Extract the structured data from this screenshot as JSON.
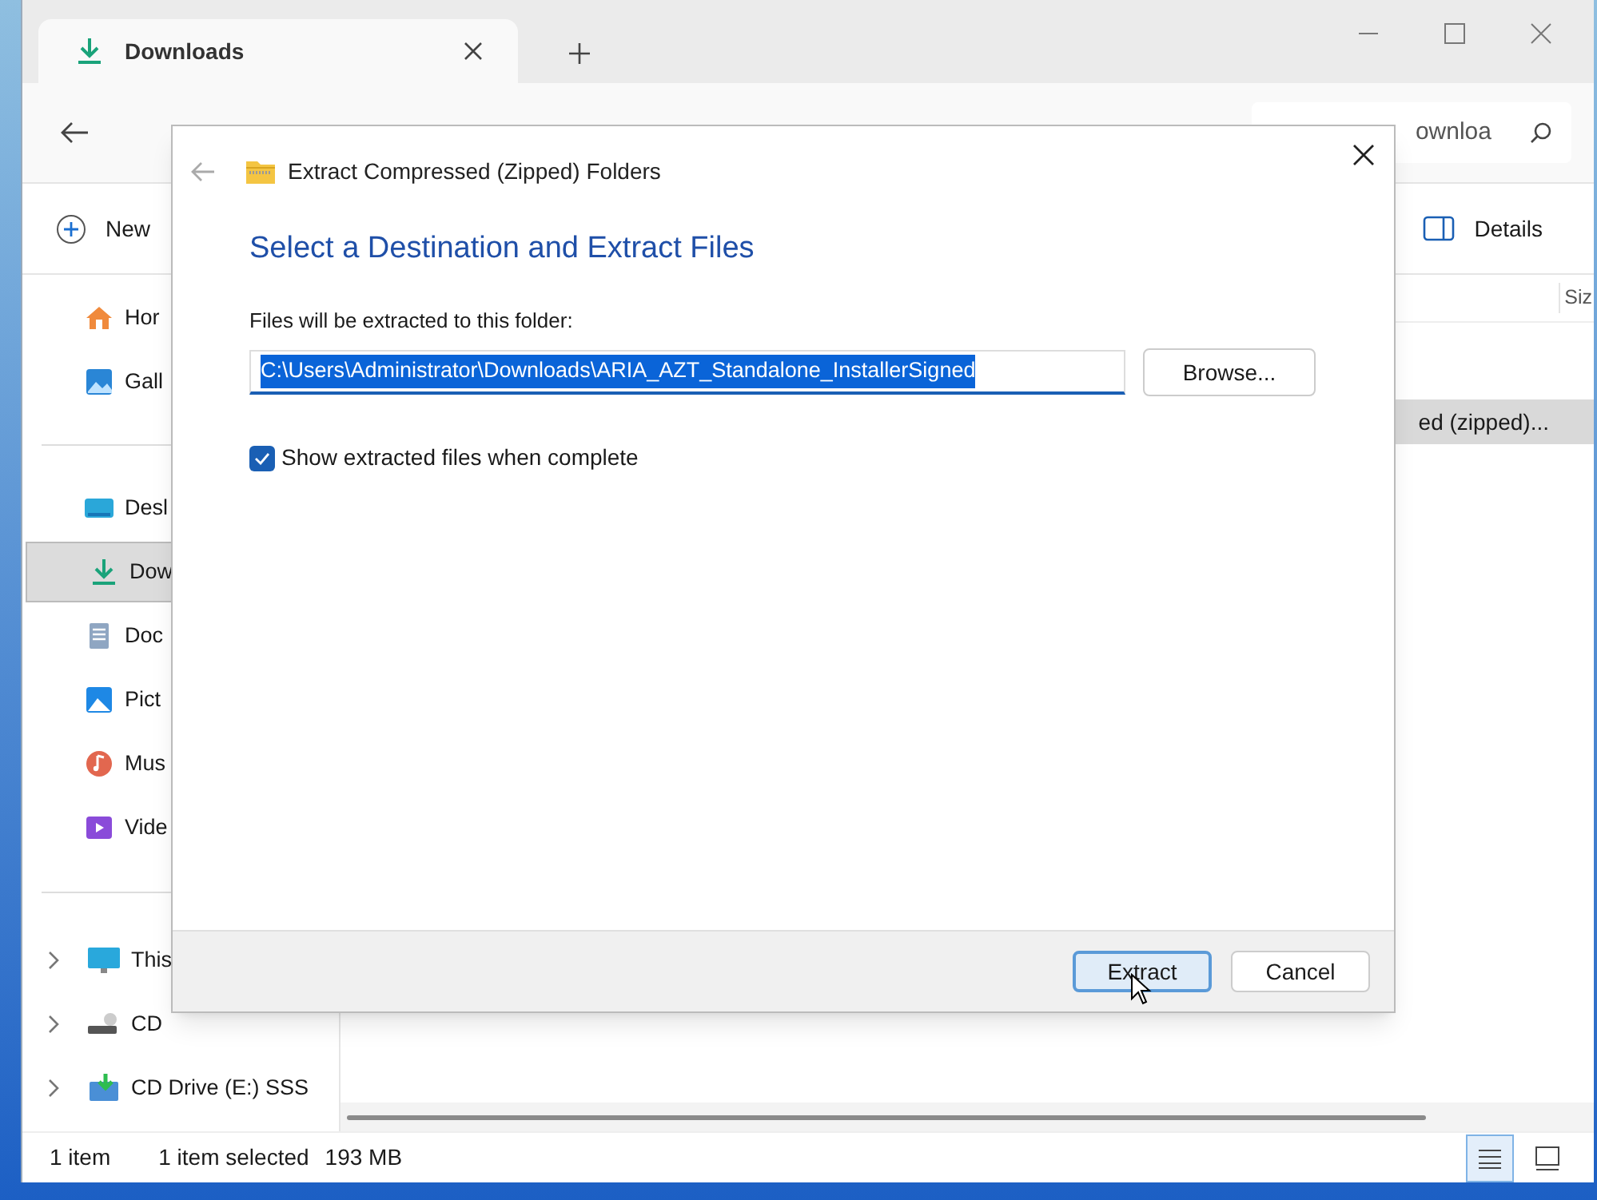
{
  "tab": {
    "title": "Downloads"
  },
  "search": {
    "placeholder": "ownloa"
  },
  "command_bar": {
    "new_label": "New",
    "details_label": "Details"
  },
  "sidebar": {
    "items": [
      {
        "label": "Hor",
        "selected": false
      },
      {
        "label": "Gall",
        "selected": false
      },
      {
        "label": "Desl",
        "selected": false
      },
      {
        "label": "Dow",
        "selected": true
      },
      {
        "label": "Doc",
        "selected": false
      },
      {
        "label": "Pict",
        "selected": false
      },
      {
        "label": "Mus",
        "selected": false
      },
      {
        "label": "Vide",
        "selected": false
      }
    ],
    "drives": [
      {
        "label": "This",
        "expanded": false
      },
      {
        "label": "CD",
        "expanded": false
      },
      {
        "label": "CD Drive (E:) SSS",
        "expanded": false
      }
    ]
  },
  "file_list": {
    "columns": [
      {
        "label": "Siz"
      }
    ],
    "rows": [
      {
        "name": "ed (zipped)...",
        "selected": true
      }
    ]
  },
  "status_bar": {
    "count": "1 item",
    "selection": "1 item selected",
    "size": "193 MB"
  },
  "view_buttons": [
    {
      "kind": "details",
      "selected": true
    },
    {
      "kind": "tiles",
      "selected": false
    }
  ],
  "dialog": {
    "title": "Extract Compressed (Zipped) Folders",
    "heading": "Select a Destination and Extract Files",
    "field_label": "Files will be extracted to this folder:",
    "path": {
      "value": "C:\\Users\\Administrator\\Downloads\\ARIA_AZT_Standalone_InstallerSigned",
      "selected": true
    },
    "browse": "Browse...",
    "show_files": {
      "label": "Show extracted files when complete",
      "checked": true
    },
    "buttons": [
      {
        "label": "Extract",
        "default": true
      },
      {
        "label": "Cancel",
        "default": false
      }
    ]
  }
}
